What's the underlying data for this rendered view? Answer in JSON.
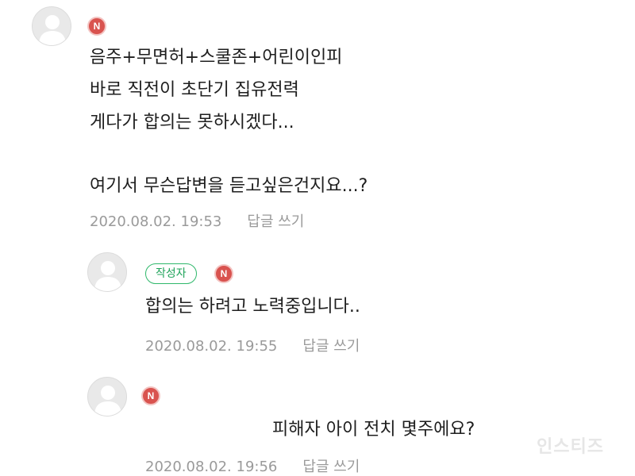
{
  "comments": [
    {
      "badge": "N",
      "lines": [
        "음주+무면허+스쿨존+어린이인피",
        "바로 직전이 초단기 집유전력",
        "게다가 합의는 못하시겠다...",
        "",
        "여기서 무슨답변을 듣고싶은건지요...?"
      ],
      "timestamp": "2020.08.02. 19:53",
      "reply_label": "답글 쓰기"
    },
    {
      "author_badge": "작성자",
      "badge": "N",
      "lines": [
        "합의는 하려고 노력중입니다.."
      ],
      "timestamp": "2020.08.02. 19:55",
      "reply_label": "답글 쓰기"
    },
    {
      "badge": "N",
      "lines": [
        "피해자 아이 전치 몇주에요?"
      ],
      "timestamp": "2020.08.02. 19:56",
      "reply_label": "답글 쓰기"
    }
  ],
  "watermark": "인스티즈",
  "colors": {
    "new_badge": "#d9534f",
    "author_badge": "#2fb86b",
    "meta_text": "#9a9a9a"
  }
}
